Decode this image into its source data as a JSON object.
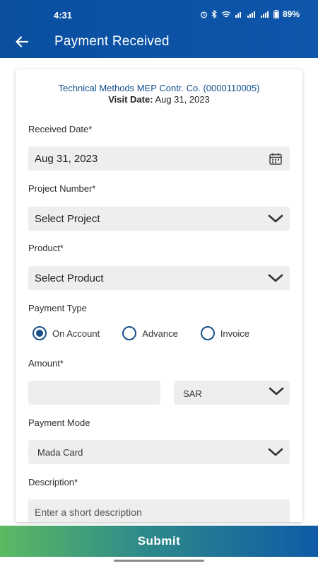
{
  "status_bar": {
    "time": "4:31",
    "battery": "89%",
    "icons": [
      "alarm-icon",
      "bluetooth-icon",
      "wifi-icon",
      "volte-icon",
      "signal-icon",
      "signal-icon",
      "battery-icon"
    ]
  },
  "app_bar": {
    "title": "Payment Received",
    "back_icon": "arrow-left-icon"
  },
  "header": {
    "customer": "Technical Methods MEP Contr. Co.  (0000110005)",
    "visit_label": "Visit Date:",
    "visit_date": "Aug 31, 2023"
  },
  "form": {
    "received_date": {
      "label": "Received Date*",
      "value": "Aug 31, 2023",
      "icon": "calendar-icon"
    },
    "project_number": {
      "label": "Project Number*",
      "value": "Select Project",
      "icon": "chevron-down-icon"
    },
    "product": {
      "label": "Product*",
      "value": "Select Product",
      "icon": "chevron-down-icon"
    },
    "payment_type": {
      "label": "Payment Type",
      "options": [
        "On Account",
        "Advance",
        "Invoice"
      ],
      "selected": "On Account"
    },
    "amount": {
      "label": "Amount*",
      "value": "",
      "currency": "SAR"
    },
    "payment_mode": {
      "label": "Payment Mode",
      "value": "Mada Card"
    },
    "description": {
      "label": "Description*",
      "placeholder": "Enter a short description"
    }
  },
  "submit_label": "Submit",
  "colors": {
    "primary": "#0d56ab",
    "radio": "#164f8a",
    "submit_start": "#5cba63",
    "submit_end": "#0f5aa6"
  }
}
